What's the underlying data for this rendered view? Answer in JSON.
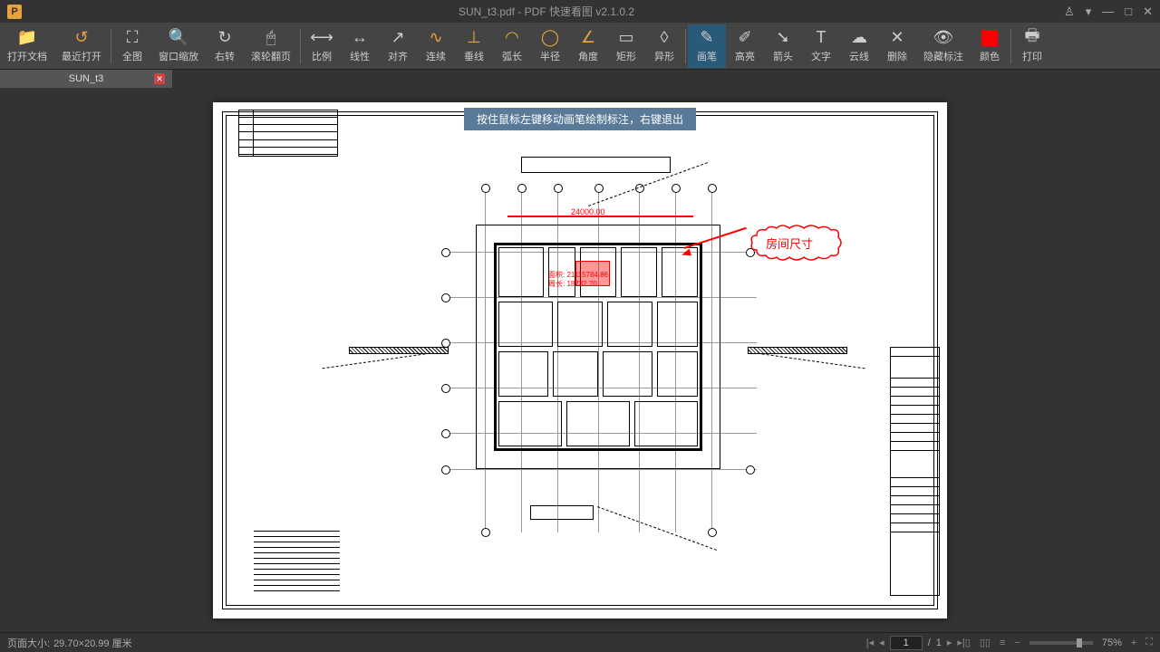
{
  "title": "SUN_t3.pdf - PDF 快速看图 v2.1.0.2",
  "tab_name": "SUN_t3",
  "tooltip": "按住鼠标左键移动画笔绘制标注，右键退出",
  "toolbar": {
    "open": "打开文档",
    "recent": "最近打开",
    "fullview": "全图",
    "winzoom": "窗口缩放",
    "rotright": "右转",
    "scrollpage": "滚轮翻页",
    "scale": "比例",
    "linear": "线性",
    "align": "对齐",
    "continuous": "连续",
    "vertical": "垂线",
    "arc": "弧长",
    "radius": "半径",
    "angle": "角度",
    "rect": "矩形",
    "anomaly": "异形",
    "brush": "画笔",
    "highlight": "高亮",
    "arrow": "箭头",
    "text": "文字",
    "cloud": "云线",
    "delete": "删除",
    "hidemark": "隐藏标注",
    "color": "颜色",
    "print": "打印"
  },
  "annotation": {
    "dim": "24000.00",
    "area_label": "面积:",
    "area_val": "21115784.86",
    "perim_label": "周长:",
    "perim_val": "18732.70",
    "cloud_text": "房间尺寸"
  },
  "status": {
    "pagesize_label": "页面大小:",
    "pagesize_val": "29.70×20.99 厘米",
    "page_current": "1",
    "page_sep": "/",
    "page_total": "1",
    "zoom": "75%"
  }
}
